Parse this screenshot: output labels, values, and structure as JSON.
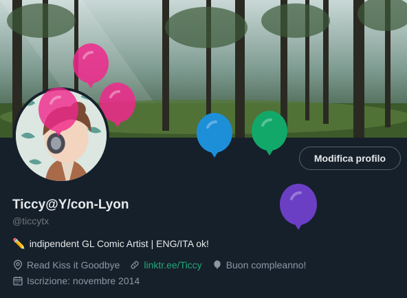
{
  "profile": {
    "display_name": "Ticcy@Y/con-Lyon",
    "handle": "@ticcytx",
    "bio_text": "indipendent GL Comic Artist | ENG/ITA ok!",
    "bio_icon": "✏️",
    "location": "Read Kiss it Goodbye",
    "website": "linktr.ee/Ticcy",
    "birthday": "Buon compleanno!",
    "joined": "Iscrizione: novembre 2014"
  },
  "actions": {
    "edit_profile_label": "Modifica profilo"
  },
  "icons": {
    "location": "location-pin-icon",
    "link": "link-icon",
    "birthday": "balloon-icon",
    "calendar": "calendar-icon"
  },
  "colors": {
    "background": "#15202b",
    "link": "#23a979",
    "balloon_pink": "#f0288c",
    "balloon_blue": "#1d8fd8",
    "balloon_green": "#12a86a",
    "balloon_purple": "#6a3fc4"
  }
}
